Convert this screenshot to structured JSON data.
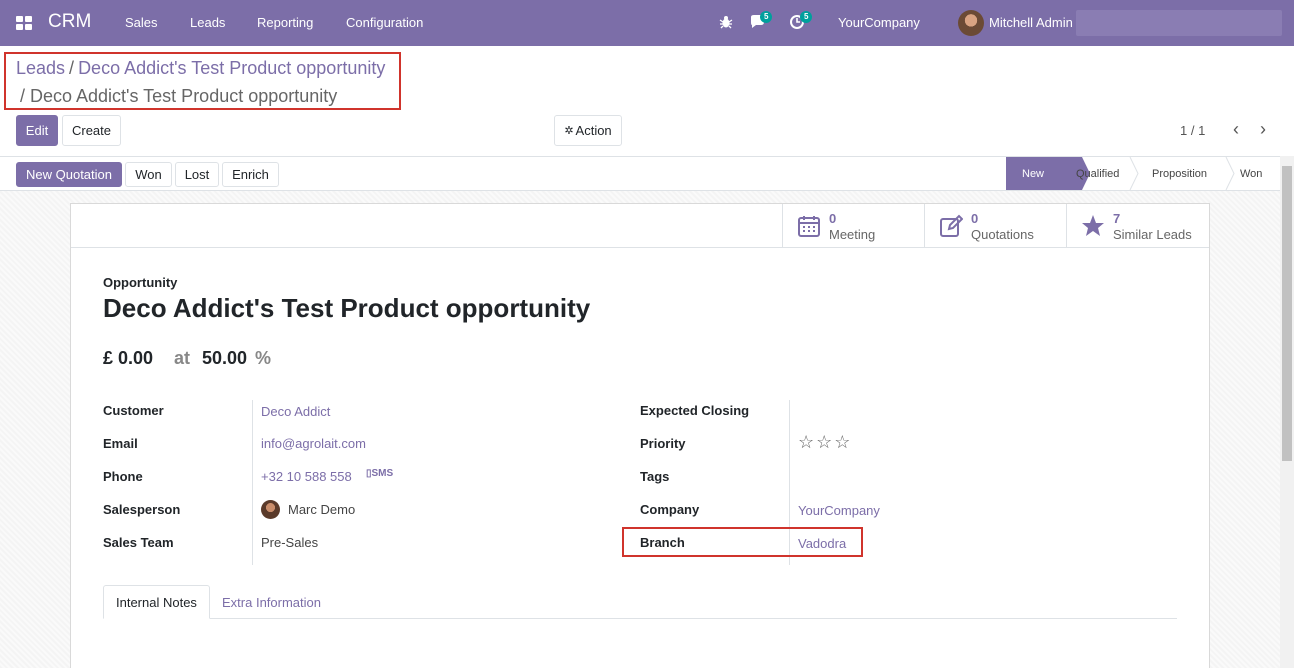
{
  "navbar": {
    "app_name": "CRM",
    "menu": [
      "Sales",
      "Leads",
      "Reporting",
      "Configuration"
    ],
    "chat_count": "5",
    "activity_count": "5",
    "company": "YourCompany",
    "user": "Mitchell Admin",
    "icons": [
      "apps-icon",
      "bug-icon",
      "chat-icon",
      "clock-icon"
    ]
  },
  "breadcrumb": {
    "items": [
      "Leads",
      "Deco Addict's Test Product opportunity"
    ],
    "sep": "/",
    "current": "/ Deco Addict's Test Product opportunity"
  },
  "toolbar": {
    "edit": "Edit",
    "create": "Create",
    "action": "Action",
    "pager": "1 / 1"
  },
  "statusbar": {
    "buttons": [
      "New Quotation",
      "Won",
      "Lost",
      "Enrich"
    ],
    "stages": [
      "New",
      "Qualified",
      "Proposition",
      "Won"
    ],
    "active_stage": "New"
  },
  "smart_buttons": [
    {
      "value": "0",
      "label": "Meeting",
      "icon": "calendar-icon"
    },
    {
      "value": "0",
      "label": "Quotations",
      "icon": "pencil-square-icon"
    },
    {
      "value": "7",
      "label": "Similar Leads",
      "icon": "star-icon"
    }
  ],
  "record": {
    "type_label": "Opportunity",
    "name": "Deco Addict's Test Product opportunity",
    "revenue": "£ 0.00",
    "at": "at",
    "probability": "50.00",
    "percent": "%"
  },
  "left_fields": [
    {
      "label": "Customer",
      "value": "Deco Addict"
    },
    {
      "label": "Email",
      "value": "info@agrolait.com"
    },
    {
      "label": "Phone",
      "value": "+32 10 588 558",
      "sms": "SMS"
    },
    {
      "label": "Salesperson",
      "value": "Marc Demo"
    },
    {
      "label": "Sales Team",
      "value": "Pre-Sales"
    }
  ],
  "right_fields": [
    {
      "label": "Expected Closing",
      "value": ""
    },
    {
      "label": "Priority",
      "value": ""
    },
    {
      "label": "Tags",
      "value": ""
    },
    {
      "label": "Company",
      "value": "YourCompany"
    },
    {
      "label": "Branch",
      "value": "Vadodra"
    }
  ],
  "priority_stars": 0,
  "tabs": [
    "Internal Notes",
    "Extra Information"
  ],
  "colors": {
    "brand": "#7c6ea8",
    "highlight": "#d0342c",
    "badge": "#00a09d"
  }
}
